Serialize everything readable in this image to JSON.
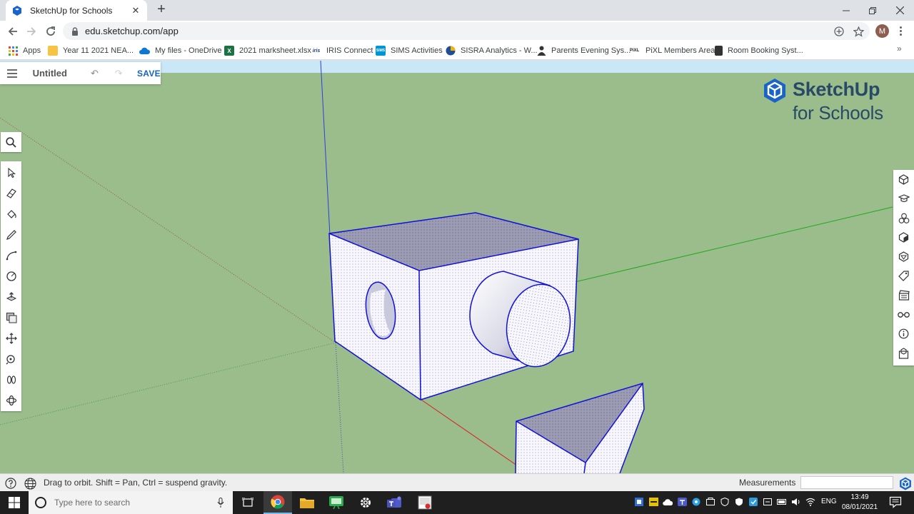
{
  "browser": {
    "tab_title": "SketchUp for Schools",
    "url": "edu.sketchup.com/app",
    "avatar_letter": "M",
    "bookmarks": [
      {
        "label": "Apps",
        "icon": "apps-grid-icon",
        "color": "#4285f4"
      },
      {
        "label": "Year 11 2021 NEA...",
        "icon": "folder-icon",
        "color": "#f6c343"
      },
      {
        "label": "My files - OneDrive",
        "icon": "onedrive-icon",
        "color": "#0f78d4"
      },
      {
        "label": "2021 marksheet.xlsx",
        "icon": "excel-icon",
        "color": "#1e7145"
      },
      {
        "label": "IRIS Connect",
        "icon": "iris-icon",
        "color": "#1a3e7a"
      },
      {
        "label": "SIMS Activities",
        "icon": "sims-icon",
        "color": "#0096d6"
      },
      {
        "label": "SISRA Analytics - W...",
        "icon": "sisra-icon",
        "color": "#e0a100"
      },
      {
        "label": "Parents Evening Sys...",
        "icon": "person-icon",
        "color": "#333333"
      },
      {
        "label": "PiXL Members Area",
        "icon": "pixl-icon",
        "color": "#222222"
      },
      {
        "label": "Room Booking Syst...",
        "icon": "book-icon",
        "color": "#333333"
      }
    ]
  },
  "sketchup": {
    "doc_title": "Untitled",
    "save_label": "SAVE",
    "logo_line1": "SketchUp",
    "logo_line2": "for Schools",
    "status_hint": "Drag to orbit. Shift = Pan, Ctrl = suspend gravity.",
    "measurements_label": "Measurements",
    "measurements_value": "",
    "colors": {
      "sky": "#c9e7f7",
      "ground": "#9bbd8c",
      "selection_edge": "#1010d8",
      "accent": "#1563c1"
    },
    "left_tools": [
      "select-tool-icon",
      "eraser-tool-icon",
      "paint-bucket-tool-icon",
      "pencil-tool-icon",
      "arc-tool-icon",
      "circle-tool-icon",
      "push-pull-tool-icon",
      "offset-tool-icon",
      "move-tool-icon",
      "tape-measure-tool-icon",
      "walk-tool-icon",
      "orbit-tool-icon"
    ],
    "right_tools": [
      "entity-info-icon",
      "instructor-icon",
      "components-icon",
      "materials-icon",
      "styles-icon",
      "tags-icon",
      "scenes-icon",
      "display-icon",
      "model-info-icon",
      "3d-warehouse-icon"
    ]
  },
  "taskbar": {
    "search_placeholder": "Type here to search",
    "language": "ENG",
    "time": "13:49",
    "date": "08/01/2021"
  }
}
